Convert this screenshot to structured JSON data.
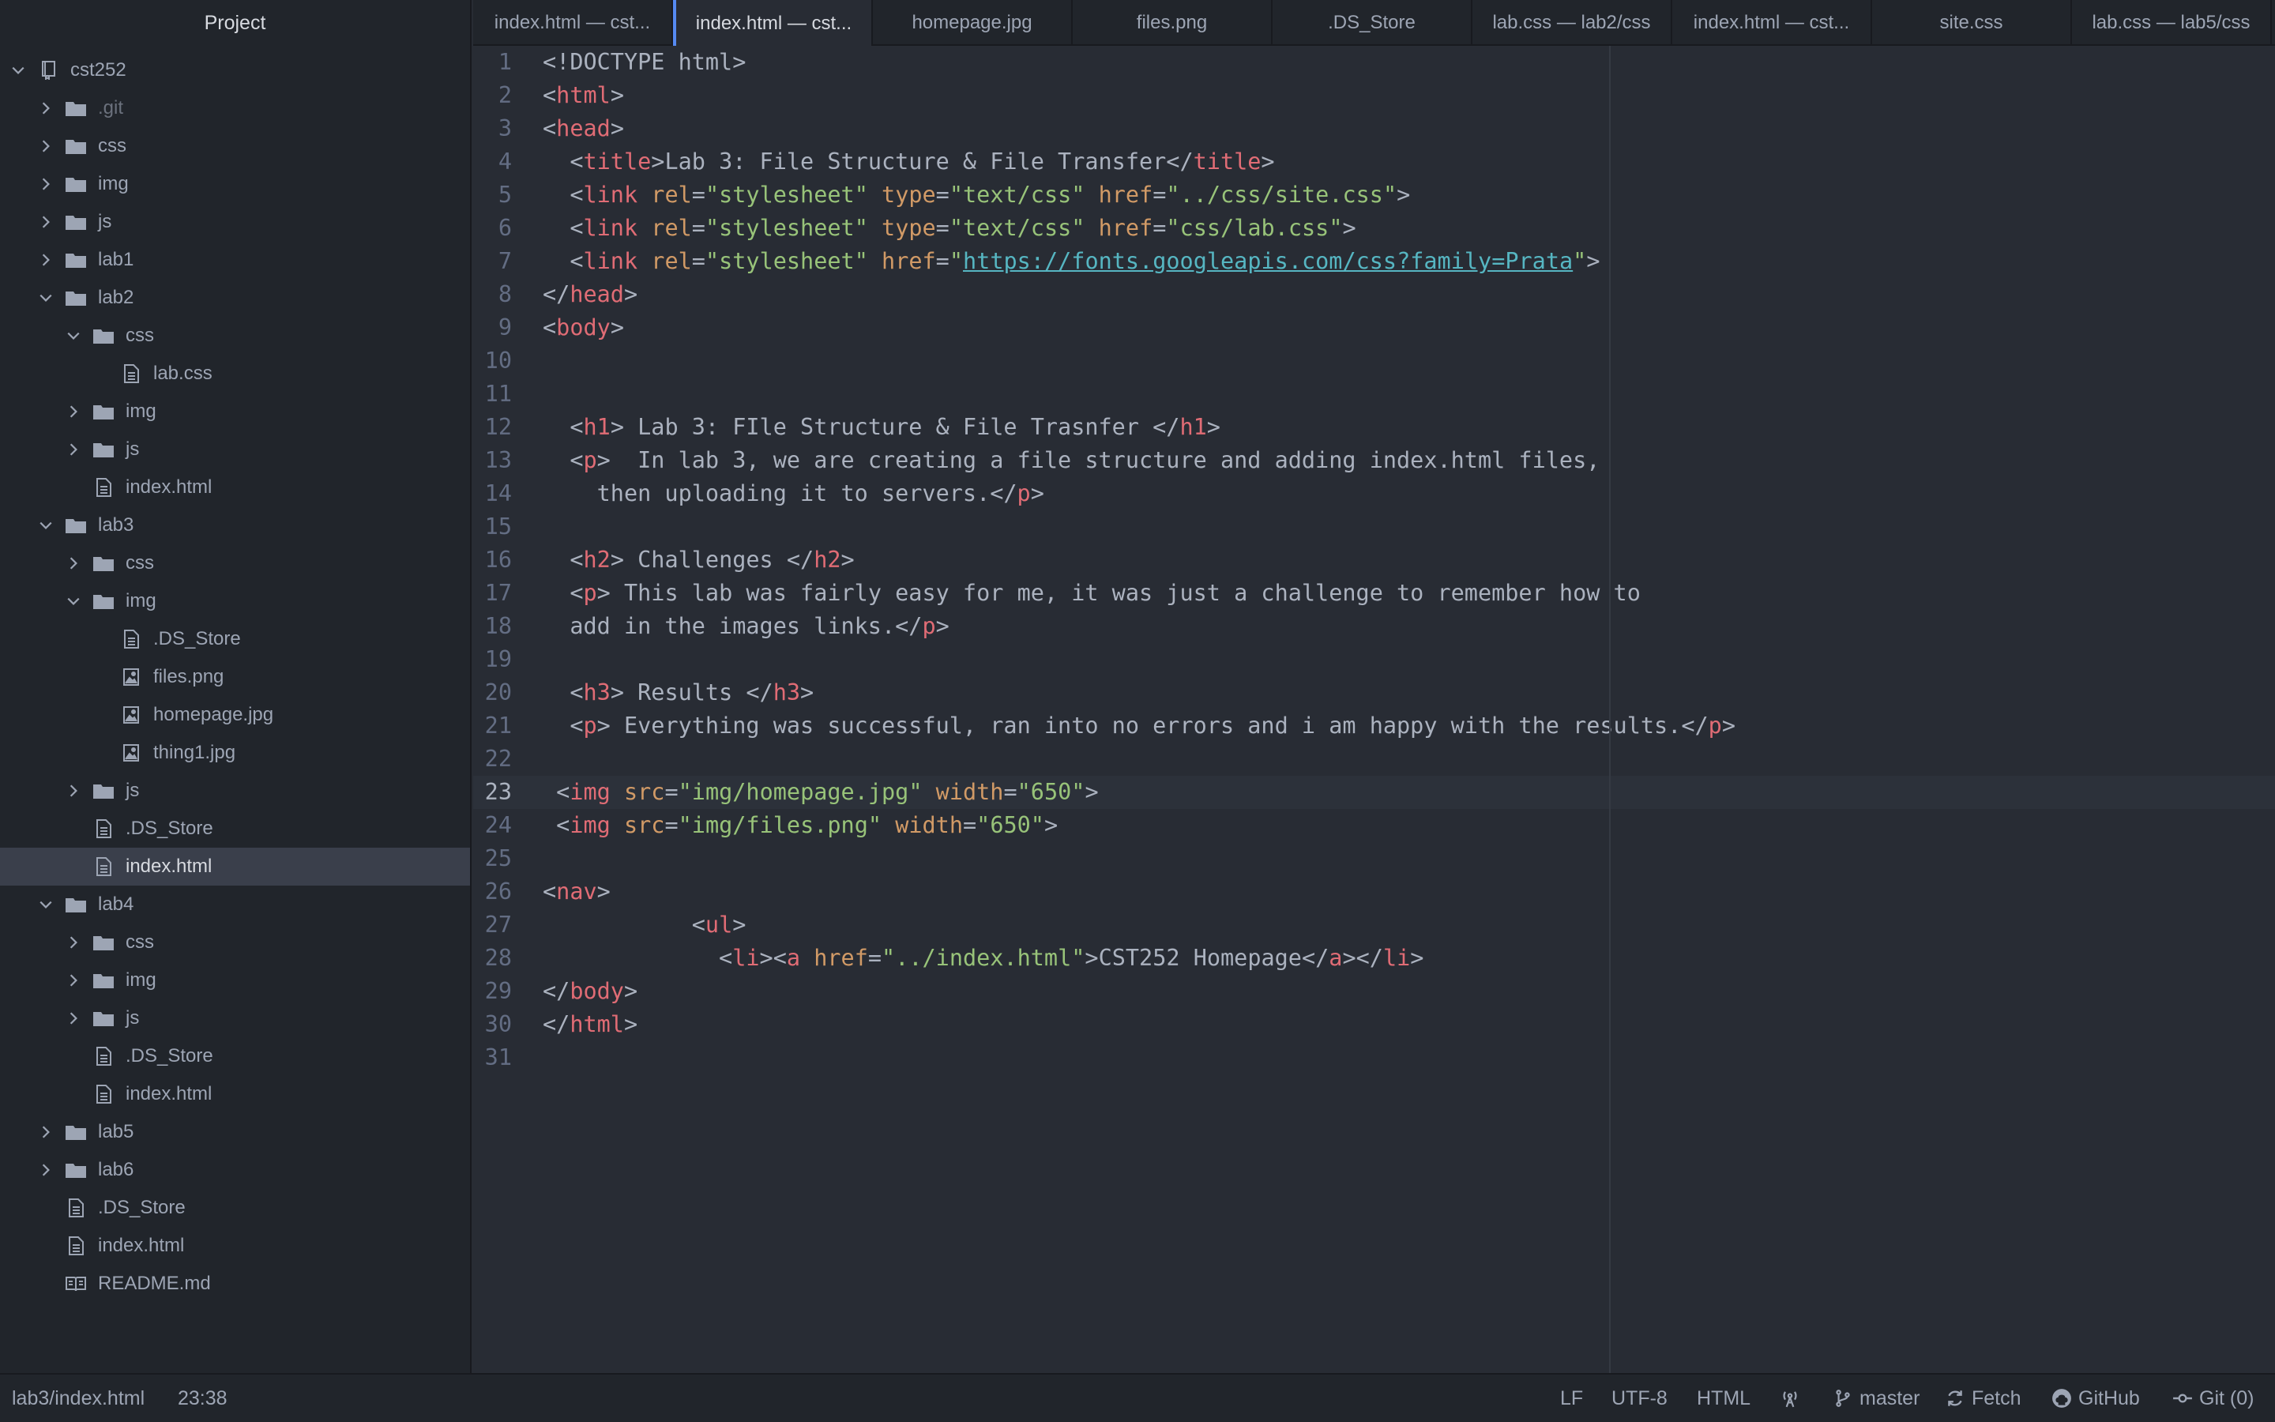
{
  "sidebar": {
    "title": "Project",
    "tree": [
      {
        "label": "cst252",
        "kind": "repo",
        "depth": 0,
        "expanded": true
      },
      {
        "label": ".git",
        "kind": "folder",
        "depth": 1,
        "expanded": false,
        "dim": true
      },
      {
        "label": "css",
        "kind": "folder",
        "depth": 1,
        "expanded": false
      },
      {
        "label": "img",
        "kind": "folder",
        "depth": 1,
        "expanded": false
      },
      {
        "label": "js",
        "kind": "folder",
        "depth": 1,
        "expanded": false
      },
      {
        "label": "lab1",
        "kind": "folder",
        "depth": 1,
        "expanded": false
      },
      {
        "label": "lab2",
        "kind": "folder",
        "depth": 1,
        "expanded": true
      },
      {
        "label": "css",
        "kind": "folder",
        "depth": 2,
        "expanded": true
      },
      {
        "label": "lab.css",
        "kind": "file",
        "depth": 3
      },
      {
        "label": "img",
        "kind": "folder",
        "depth": 2,
        "expanded": false
      },
      {
        "label": "js",
        "kind": "folder",
        "depth": 2,
        "expanded": false
      },
      {
        "label": "index.html",
        "kind": "file",
        "depth": 2
      },
      {
        "label": "lab3",
        "kind": "folder",
        "depth": 1,
        "expanded": true
      },
      {
        "label": "css",
        "kind": "folder",
        "depth": 2,
        "expanded": false
      },
      {
        "label": "img",
        "kind": "folder",
        "depth": 2,
        "expanded": true
      },
      {
        "label": ".DS_Store",
        "kind": "file",
        "depth": 3
      },
      {
        "label": "files.png",
        "kind": "image",
        "depth": 3
      },
      {
        "label": "homepage.jpg",
        "kind": "image",
        "depth": 3
      },
      {
        "label": "thing1.jpg",
        "kind": "image",
        "depth": 3
      },
      {
        "label": "js",
        "kind": "folder",
        "depth": 2,
        "expanded": false
      },
      {
        "label": ".DS_Store",
        "kind": "file",
        "depth": 2
      },
      {
        "label": "index.html",
        "kind": "file",
        "depth": 2,
        "selected": true
      },
      {
        "label": "lab4",
        "kind": "folder",
        "depth": 1,
        "expanded": true
      },
      {
        "label": "css",
        "kind": "folder",
        "depth": 2,
        "expanded": false
      },
      {
        "label": "img",
        "kind": "folder",
        "depth": 2,
        "expanded": false
      },
      {
        "label": "js",
        "kind": "folder",
        "depth": 2,
        "expanded": false
      },
      {
        "label": ".DS_Store",
        "kind": "file",
        "depth": 2
      },
      {
        "label": "index.html",
        "kind": "file",
        "depth": 2
      },
      {
        "label": "lab5",
        "kind": "folder",
        "depth": 1,
        "expanded": false
      },
      {
        "label": "lab6",
        "kind": "folder",
        "depth": 1,
        "expanded": false
      },
      {
        "label": ".DS_Store",
        "kind": "file",
        "depth": 1
      },
      {
        "label": "index.html",
        "kind": "file",
        "depth": 1
      },
      {
        "label": "README.md",
        "kind": "book",
        "depth": 1
      }
    ]
  },
  "tabs": [
    {
      "label": "index.html — cst...",
      "active": false
    },
    {
      "label": "index.html — cst...",
      "active": true
    },
    {
      "label": "homepage.jpg",
      "active": false
    },
    {
      "label": "files.png",
      "active": false
    },
    {
      "label": ".DS_Store",
      "active": false
    },
    {
      "label": "lab.css — lab2/css",
      "active": false
    },
    {
      "label": "index.html — cst...",
      "active": false
    },
    {
      "label": "site.css",
      "active": false
    },
    {
      "label": "lab.css — lab5/css",
      "active": false
    }
  ],
  "editor": {
    "current_line": 23,
    "lines": [
      [
        [
          "txt",
          "<!DOCTYPE html>"
        ]
      ],
      [
        [
          "txt",
          "<"
        ],
        [
          "tag",
          "html"
        ],
        [
          "txt",
          ">"
        ]
      ],
      [
        [
          "txt",
          "<"
        ],
        [
          "tag",
          "head"
        ],
        [
          "txt",
          ">"
        ]
      ],
      [
        [
          "txt",
          "  <"
        ],
        [
          "tag",
          "title"
        ],
        [
          "txt",
          ">Lab 3: File Structure & File Transfer</"
        ],
        [
          "tag",
          "title"
        ],
        [
          "txt",
          ">"
        ]
      ],
      [
        [
          "txt",
          "  <"
        ],
        [
          "tag",
          "link"
        ],
        [
          "txt",
          " "
        ],
        [
          "attr",
          "rel"
        ],
        [
          "txt",
          "="
        ],
        [
          "str",
          "\"stylesheet\""
        ],
        [
          "txt",
          " "
        ],
        [
          "attr",
          "type"
        ],
        [
          "txt",
          "="
        ],
        [
          "str",
          "\"text/css\""
        ],
        [
          "txt",
          " "
        ],
        [
          "attr",
          "href"
        ],
        [
          "txt",
          "="
        ],
        [
          "str",
          "\"../css/site.css\""
        ],
        [
          "txt",
          ">"
        ]
      ],
      [
        [
          "txt",
          "  <"
        ],
        [
          "tag",
          "link"
        ],
        [
          "txt",
          " "
        ],
        [
          "attr",
          "rel"
        ],
        [
          "txt",
          "="
        ],
        [
          "str",
          "\"stylesheet\""
        ],
        [
          "txt",
          " "
        ],
        [
          "attr",
          "type"
        ],
        [
          "txt",
          "="
        ],
        [
          "str",
          "\"text/css\""
        ],
        [
          "txt",
          " "
        ],
        [
          "attr",
          "href"
        ],
        [
          "txt",
          "="
        ],
        [
          "str",
          "\"css/lab.css\""
        ],
        [
          "txt",
          ">"
        ]
      ],
      [
        [
          "txt",
          "  <"
        ],
        [
          "tag",
          "link"
        ],
        [
          "txt",
          " "
        ],
        [
          "attr",
          "rel"
        ],
        [
          "txt",
          "="
        ],
        [
          "str",
          "\"stylesheet\""
        ],
        [
          "txt",
          " "
        ],
        [
          "attr",
          "href"
        ],
        [
          "txt",
          "="
        ],
        [
          "str",
          "\""
        ],
        [
          "url",
          "https://fonts.googleapis.com/css?family=Prata"
        ],
        [
          "str",
          "\""
        ],
        [
          "txt",
          ">"
        ]
      ],
      [
        [
          "txt",
          "</"
        ],
        [
          "tag",
          "head"
        ],
        [
          "txt",
          ">"
        ]
      ],
      [
        [
          "txt",
          "<"
        ],
        [
          "tag",
          "body"
        ],
        [
          "txt",
          ">"
        ]
      ],
      [],
      [],
      [
        [
          "txt",
          "  <"
        ],
        [
          "tag",
          "h1"
        ],
        [
          "txt",
          "> Lab 3: FIle Structure & File Trasnfer </"
        ],
        [
          "tag",
          "h1"
        ],
        [
          "txt",
          ">"
        ]
      ],
      [
        [
          "txt",
          "  <"
        ],
        [
          "tag",
          "p"
        ],
        [
          "txt",
          ">  In lab 3, we are creating a file structure and adding index.html files,"
        ]
      ],
      [
        [
          "txt",
          "    then uploading it to servers.</"
        ],
        [
          "tag",
          "p"
        ],
        [
          "txt",
          ">"
        ]
      ],
      [],
      [
        [
          "txt",
          "  <"
        ],
        [
          "tag",
          "h2"
        ],
        [
          "txt",
          "> Challenges </"
        ],
        [
          "tag",
          "h2"
        ],
        [
          "txt",
          ">"
        ]
      ],
      [
        [
          "txt",
          "  <"
        ],
        [
          "tag",
          "p"
        ],
        [
          "txt",
          "> This lab was fairly easy for me, it was just a challenge to remember how to"
        ]
      ],
      [
        [
          "txt",
          "  add in the images links.</"
        ],
        [
          "tag",
          "p"
        ],
        [
          "txt",
          ">"
        ]
      ],
      [],
      [
        [
          "txt",
          "  <"
        ],
        [
          "tag",
          "h3"
        ],
        [
          "txt",
          "> Results </"
        ],
        [
          "tag",
          "h3"
        ],
        [
          "txt",
          ">"
        ]
      ],
      [
        [
          "txt",
          "  <"
        ],
        [
          "tag",
          "p"
        ],
        [
          "txt",
          "> Everything was successful, ran into no errors and i am happy with the results.</"
        ],
        [
          "tag",
          "p"
        ],
        [
          "txt",
          ">"
        ]
      ],
      [],
      [
        [
          "txt",
          " <"
        ],
        [
          "tag",
          "img"
        ],
        [
          "txt",
          " "
        ],
        [
          "attr",
          "src"
        ],
        [
          "txt",
          "="
        ],
        [
          "str",
          "\"img/homepage.jpg\""
        ],
        [
          "txt",
          " "
        ],
        [
          "attr",
          "width"
        ],
        [
          "txt",
          "="
        ],
        [
          "str",
          "\"650\""
        ],
        [
          "txt",
          ">"
        ]
      ],
      [
        [
          "txt",
          " <"
        ],
        [
          "tag",
          "img"
        ],
        [
          "txt",
          " "
        ],
        [
          "attr",
          "src"
        ],
        [
          "txt",
          "="
        ],
        [
          "str",
          "\"img/files.png\""
        ],
        [
          "txt",
          " "
        ],
        [
          "attr",
          "width"
        ],
        [
          "txt",
          "="
        ],
        [
          "str",
          "\"650\""
        ],
        [
          "txt",
          ">"
        ]
      ],
      [],
      [
        [
          "txt",
          "<"
        ],
        [
          "tag",
          "nav"
        ],
        [
          "txt",
          ">"
        ]
      ],
      [
        [
          "txt",
          "           <"
        ],
        [
          "tag",
          "ul"
        ],
        [
          "txt",
          ">"
        ]
      ],
      [
        [
          "txt",
          "             <"
        ],
        [
          "tag",
          "li"
        ],
        [
          "txt",
          "><"
        ],
        [
          "tag",
          "a"
        ],
        [
          "txt",
          " "
        ],
        [
          "attr",
          "href"
        ],
        [
          "txt",
          "="
        ],
        [
          "str",
          "\"../index.html\""
        ],
        [
          "txt",
          ">CST252 Homepage</"
        ],
        [
          "tag",
          "a"
        ],
        [
          "txt",
          "></"
        ],
        [
          "tag",
          "li"
        ],
        [
          "txt",
          ">"
        ]
      ],
      [
        [
          "txt",
          "</"
        ],
        [
          "tag",
          "body"
        ],
        [
          "txt",
          ">"
        ]
      ],
      [
        [
          "txt",
          "</"
        ],
        [
          "tag",
          "html"
        ],
        [
          "txt",
          ">"
        ]
      ],
      []
    ]
  },
  "statusbar": {
    "file_path": "lab3/index.html",
    "cursor": "23:38",
    "line_ending": "LF",
    "encoding": "UTF-8",
    "grammar": "HTML",
    "branch": "master",
    "fetch": "Fetch",
    "github": "GitHub",
    "git": "Git (0)"
  },
  "colors": {
    "tag": "#e06c75",
    "attr": "#d19a66",
    "string": "#98c379",
    "url": "#56b6c2",
    "accent": "#568af2"
  }
}
